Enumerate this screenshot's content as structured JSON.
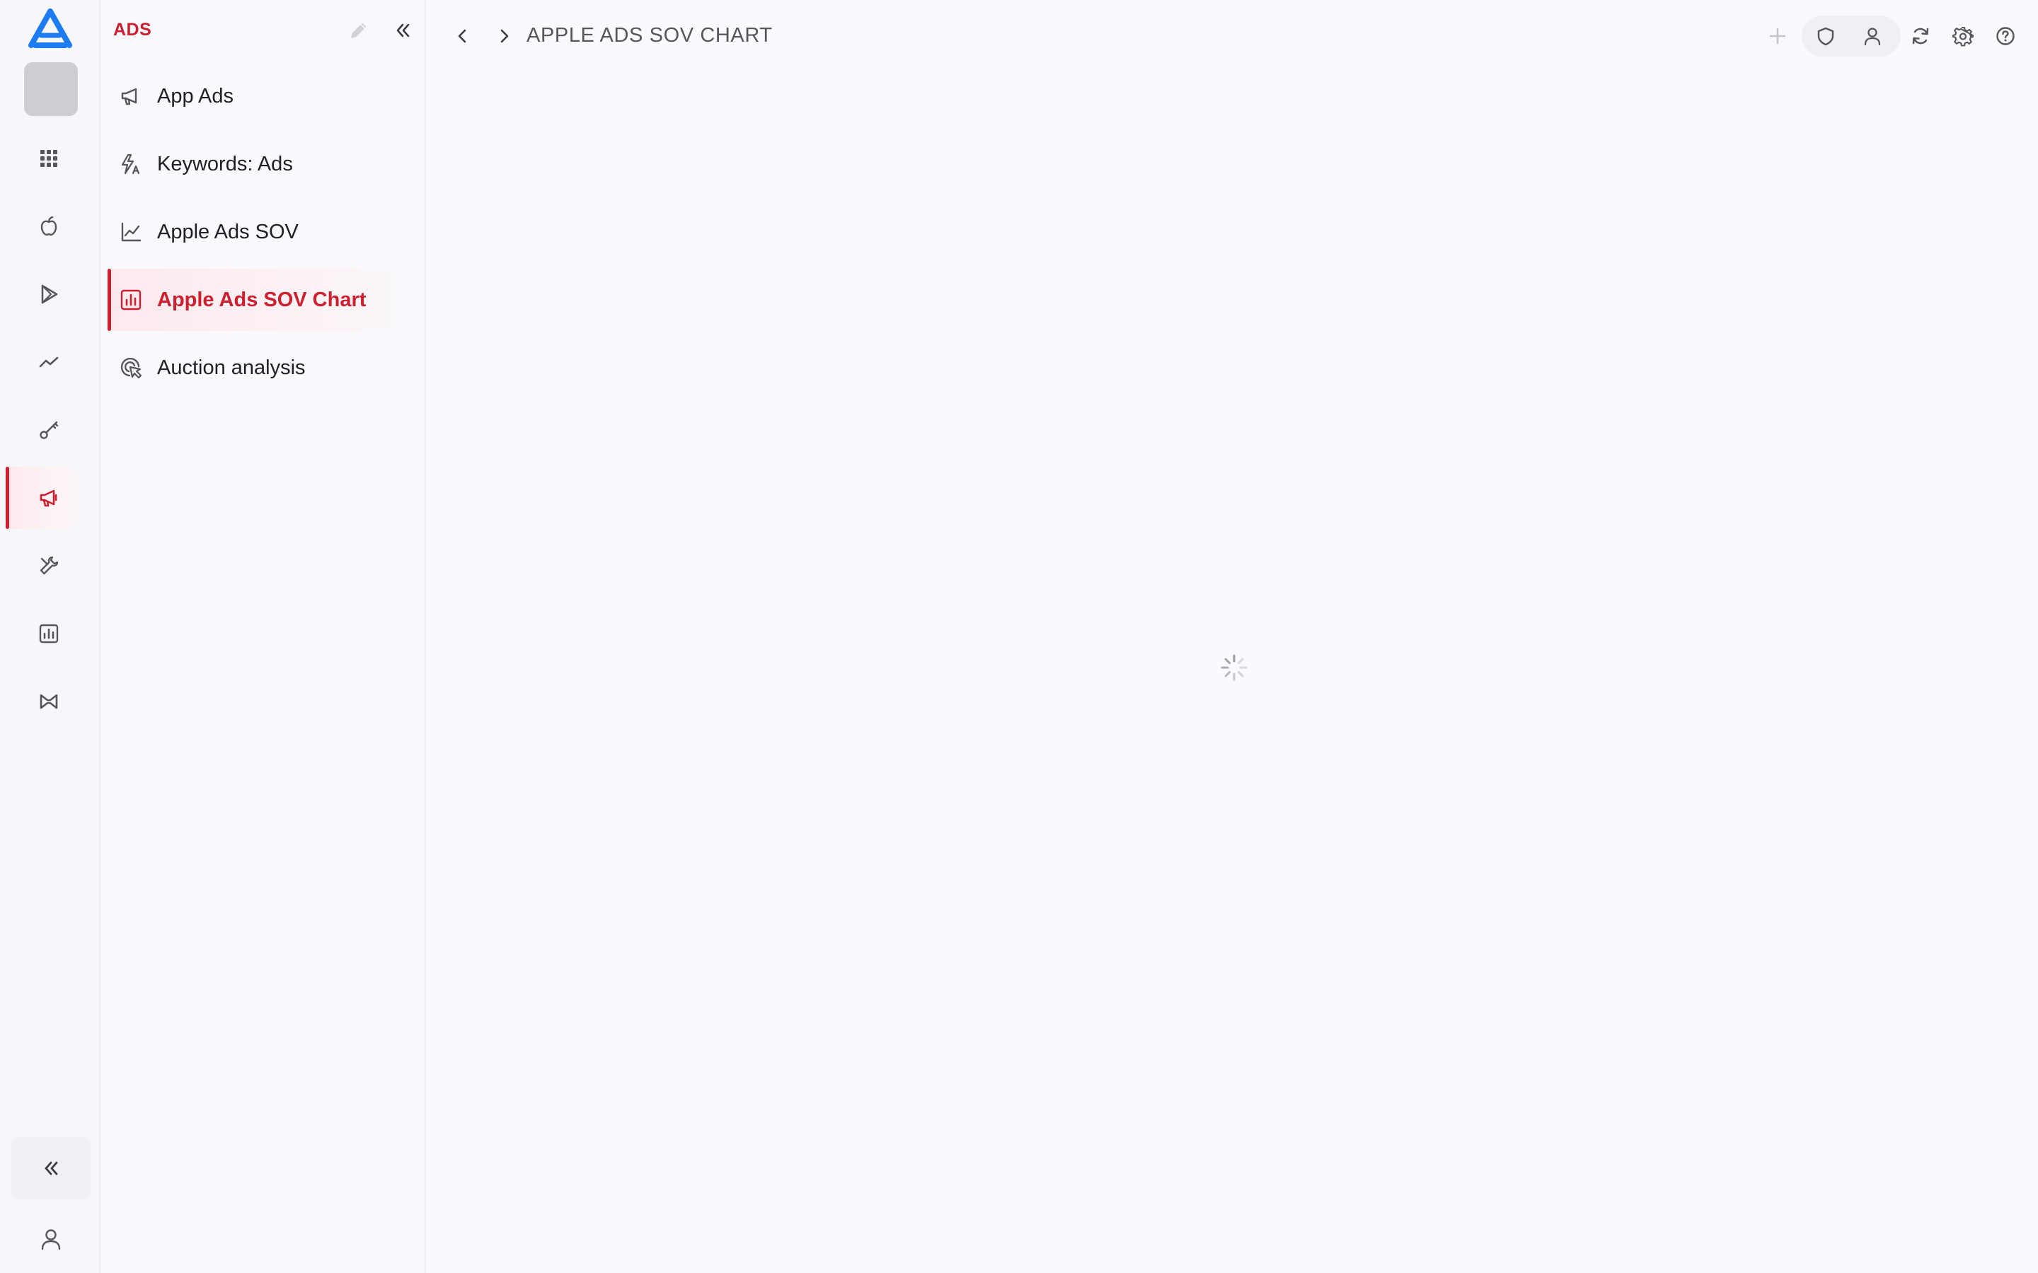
{
  "colors": {
    "accent": "#cc1f2f",
    "icon": "#55555e",
    "logo": "#1d7cf2"
  },
  "rail": {
    "logo_icon": "app-store-logo",
    "items": [
      {
        "icon": "grid-icon",
        "active": false
      },
      {
        "icon": "apple-icon",
        "active": false
      },
      {
        "icon": "google-play-icon",
        "active": false
      },
      {
        "icon": "trend-icon",
        "active": false
      },
      {
        "icon": "key-icon",
        "active": false
      },
      {
        "icon": "megaphone-icon",
        "active": true
      },
      {
        "icon": "tools-icon",
        "active": false
      },
      {
        "icon": "chart-icon",
        "active": false
      },
      {
        "icon": "bowtie-icon",
        "active": false
      }
    ]
  },
  "panel": {
    "title": "ADS",
    "items": [
      {
        "label": "App Ads",
        "icon": "megaphone-icon",
        "active": false
      },
      {
        "label": "Keywords: Ads",
        "icon": "keyword-ads-icon",
        "active": false
      },
      {
        "label": "Apple Ads SOV",
        "icon": "line-chart-icon",
        "active": false
      },
      {
        "label": "Apple Ads SOV Chart",
        "icon": "bar-chart-icon",
        "active": true
      },
      {
        "label": "Auction analysis",
        "icon": "auction-icon",
        "active": false
      }
    ]
  },
  "header": {
    "breadcrumb": "APPLE ADS SOV CHART"
  },
  "main": {
    "loading": true
  }
}
